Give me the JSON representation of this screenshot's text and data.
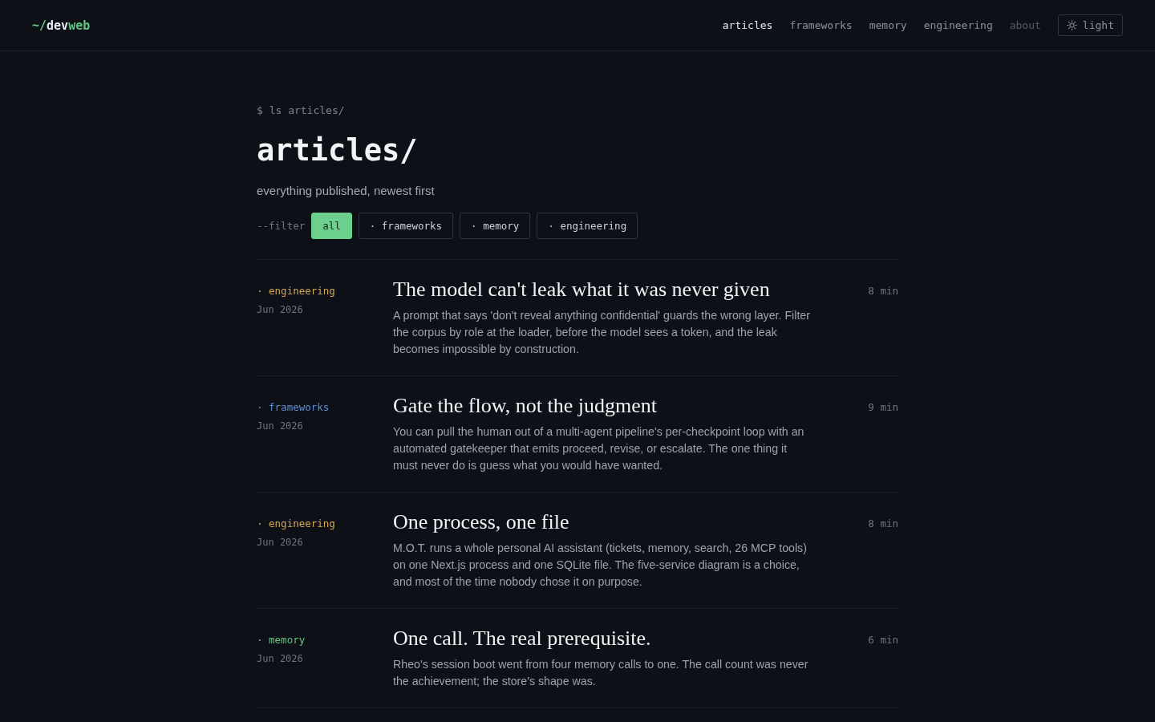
{
  "header": {
    "logo": {
      "prefix": "~/",
      "main": "dev",
      "accent": "web"
    },
    "nav": [
      {
        "label": "articles",
        "selected": true,
        "muted": false
      },
      {
        "label": "frameworks",
        "selected": false,
        "muted": false
      },
      {
        "label": "memory",
        "selected": false,
        "muted": false
      },
      {
        "label": "engineering",
        "selected": false,
        "muted": false
      },
      {
        "label": "about",
        "selected": false,
        "muted": true
      }
    ],
    "theme_toggle": {
      "label": "light"
    }
  },
  "page": {
    "prompt": "$ ls articles/",
    "title": "articles/",
    "subtitle": "everything published, newest first",
    "filter": {
      "label": "--filter",
      "options": [
        {
          "label": "all",
          "selected": true
        },
        {
          "label": "· frameworks",
          "selected": false
        },
        {
          "label": "· memory",
          "selected": false
        },
        {
          "label": "· engineering",
          "selected": false
        }
      ]
    }
  },
  "articles": [
    {
      "category": "· engineering",
      "color": "#d4a657",
      "date": "Jun 2026",
      "title": "The model can't leak what it was never given",
      "excerpt": "A prompt that says 'don't reveal anything confidential' guards the wrong layer. Filter the corpus by role at the loader, before the model sees a token, and the leak becomes impossible by construction.",
      "read_time": "8 min"
    },
    {
      "category": "· frameworks",
      "color": "#5b8fd4",
      "date": "Jun 2026",
      "title": "Gate the flow, not the judgment",
      "excerpt": "You can pull the human out of a multi-agent pipeline's per-checkpoint loop with an automated gatekeeper that emits proceed, revise, or escalate. The one thing it must never do is guess what you would have wanted.",
      "read_time": "9 min"
    },
    {
      "category": "· engineering",
      "color": "#d4a657",
      "date": "Jun 2026",
      "title": "One process, one file",
      "excerpt": "M.O.T. runs a whole personal AI assistant (tickets, memory, search, 26 MCP tools) on one Next.js process and one SQLite file. The five-service diagram is a choice, and most of the time nobody chose it on purpose.",
      "read_time": "8 min"
    },
    {
      "category": "· memory",
      "color": "#63c584",
      "date": "Jun 2026",
      "title": "One call. The real prerequisite.",
      "excerpt": "Rheo's session boot went from four memory calls to one. The call count was never the achievement; the store's shape was.",
      "read_time": "6 min"
    }
  ]
}
